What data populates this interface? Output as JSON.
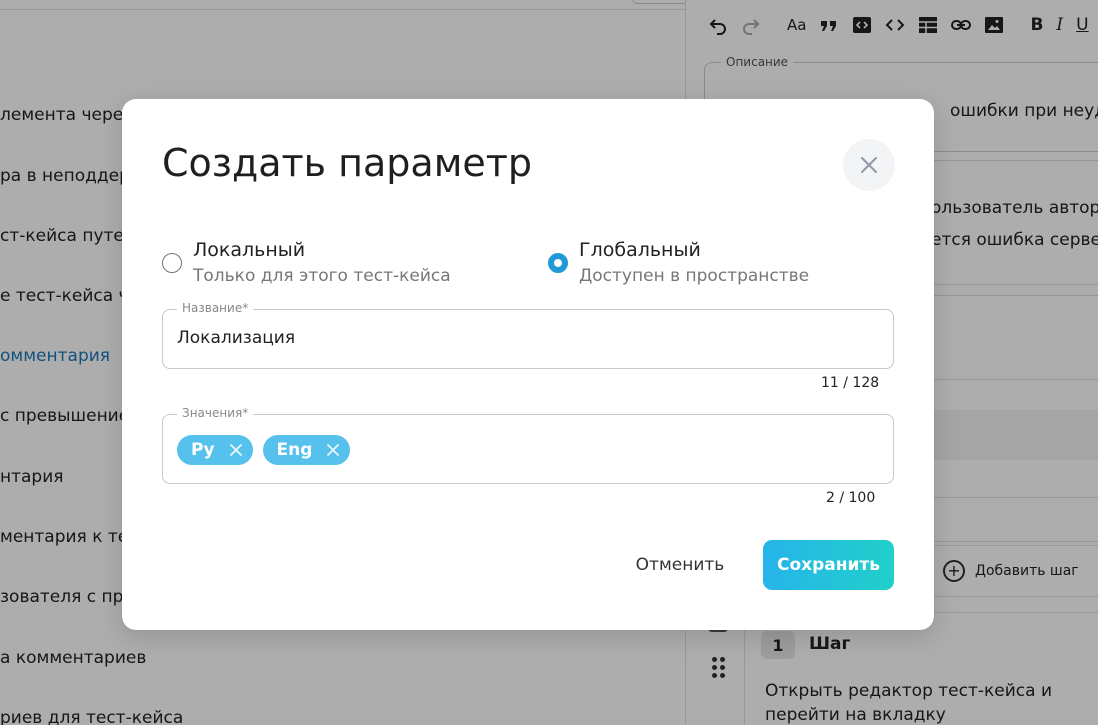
{
  "background": {
    "list_items": [
      {
        "text": "лемента через",
        "link": false
      },
      {
        "text": "ра в неподдер",
        "link": false
      },
      {
        "text": "ст-кейса путем",
        "link": false
      },
      {
        "text": "е тест-кейса ч",
        "link": false
      },
      {
        "text": "омментария",
        "link": true
      },
      {
        "text": "с превышением",
        "link": false
      },
      {
        "text": "нтария",
        "link": false
      },
      {
        "text": "ментария к тес",
        "link": false
      },
      {
        "text": "зователя с пра",
        "link": false
      },
      {
        "text": "а комментариев",
        "link": false
      },
      {
        "text": "риев для тест-кейса",
        "link": false
      }
    ],
    "editor": {
      "toolbar": {
        "undo_icon": "undo-icon",
        "redo_icon": "redo-icon",
        "font_size_label": "Aa",
        "quote_icon": "quote-icon",
        "code_block_icon": "code-block-icon",
        "code_icon": "code-icon",
        "table_icon": "table-icon",
        "link_icon": "link-icon",
        "image_icon": "image-icon",
        "bold_label": "B",
        "italic_label": "I",
        "underline_label": "U"
      },
      "description_legend": "Описание",
      "description_fragment": "ошибки при неудачн",
      "fragment_line_1": "ользователь автор",
      "fragment_line_2": "ется ошибка сервер",
      "add_step_label": "Добавить шаг",
      "step": {
        "number": "1",
        "title": "Шаг",
        "text_line_1": "Открыть редактор тест-кейса и",
        "text_line_2": "перейти на вкладку"
      }
    }
  },
  "modal": {
    "title": "Создать параметр",
    "close_icon": "close-icon",
    "scope_options": [
      {
        "label": "Локальный",
        "description": "Только для этого тест-кейса",
        "selected": false
      },
      {
        "label": "Глобальный",
        "description": "Доступен в пространстве",
        "selected": true
      }
    ],
    "name_field": {
      "legend": "Название*",
      "value": "Локализация",
      "counter": "11 / 128"
    },
    "values_field": {
      "legend": "Значения*",
      "chips": [
        "Ру",
        "Eng"
      ],
      "counter": "2 / 100"
    },
    "cancel_label": "Отменить",
    "save_label": "Сохранить"
  },
  "colors": {
    "accent": "#1f9ad6",
    "chip": "#55c1ec",
    "save_gradient_start": "#26b4ea",
    "save_gradient_end": "#21d0c9",
    "link": "#1a7ab8"
  }
}
